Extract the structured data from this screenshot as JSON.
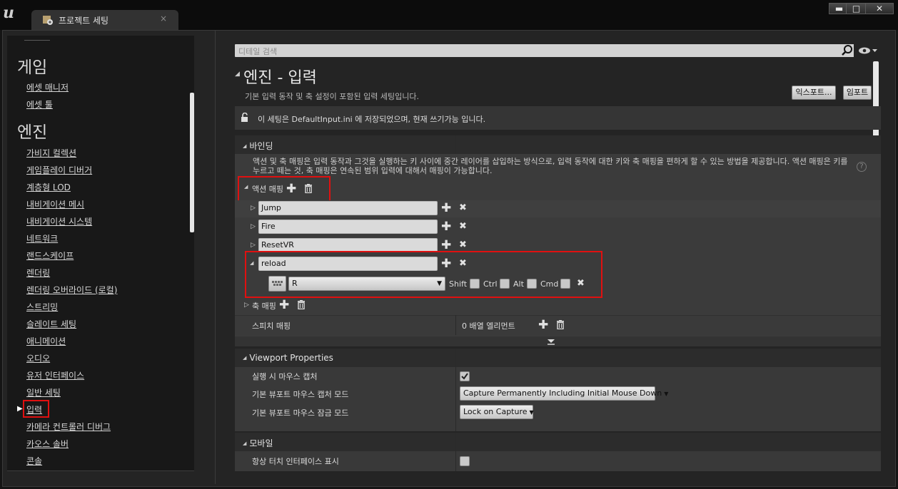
{
  "window": {
    "tab_label": "프로젝트 세팅",
    "tab_close": "×",
    "buttons": {
      "minimize": "▬",
      "maximize": "□",
      "close": "✕"
    }
  },
  "sidebar": {
    "sections": [
      {
        "title": "게임",
        "items": [
          "에셋 매니저",
          "에셋 툴"
        ]
      },
      {
        "title": "엔진",
        "items": [
          "가비지 컬렉션",
          "게임플레이 디버거",
          "계층형 LOD",
          "내비게이션 메시",
          "내비게이션 시스템",
          "네트워크",
          "랜드스케이프",
          "렌더링",
          "렌더링 오버라이드 (로컬)",
          "스트리밍",
          "슬레이트 세팅",
          "애니메이션",
          "오디오",
          "유저 인터페이스",
          "일반 세팅",
          "입력",
          "카메라 컨트롤러 디버그",
          "카오스 솔버",
          "콘솔"
        ]
      }
    ],
    "selected_item": "입력"
  },
  "search": {
    "placeholder": "디테일 검색"
  },
  "page": {
    "title": "엔진 - 입력",
    "description": "기본 입력 동작 및 축 설정이 포함된 입력 세팅입니다.",
    "export_label": "익스포트...",
    "import_label": "임포트",
    "info": "이 세팅은 DefaultInput.ini 에 저장되었으며, 현재 쓰기가능 입니다."
  },
  "bindings": {
    "title": "바인딩",
    "description": "액션 및 축 매핑은 입력 동작과 그것을 실행하는 키 사이에 중간 레이어를 삽입하는 방식으로, 입력 동작에 대한 키와 축 매핑을 편하게 할 수 있는 방법을 제공합니다. 액션 매핑은 키를 누르고 떼는 것, 축 매핑은 연속된 범위 입력에 대해서 매핑이 가능합니다.",
    "help": "?",
    "action_mappings_label": "액션 매핑",
    "actions": [
      "Jump",
      "Fire",
      "ResetVR",
      "reload"
    ],
    "reload_key": "R",
    "modifiers": [
      "Shift",
      "Ctrl",
      "Alt",
      "Cmd"
    ],
    "axis_mappings_label": "축 매핑",
    "speech_label": "스피치 매핑",
    "speech_value": "0 배열 엘리먼트"
  },
  "viewport": {
    "title": "Viewport Properties",
    "capture_on_play_label": "실행 시 마우스 캡처",
    "capture_on_play": true,
    "capture_mode_label": "기본 뷰포트 마우스 캡처 모드",
    "capture_mode_value": "Capture Permanently Including Initial Mouse Down",
    "lock_mode_label": "기본 뷰포트 마우스 잠금 모드",
    "lock_mode_value": "Lock on Capture"
  },
  "mobile": {
    "title": "모바일",
    "touch_interface_label": "항상 터치 인터페이스 표시",
    "touch_interface": false
  },
  "icons": {
    "plus": "✚",
    "close": "✖",
    "expanded_arrow": "◢",
    "collapsed_arrow": "▷",
    "selected_arrow": "▶",
    "dropdown_arrow": "▼"
  },
  "colors": {
    "highlight_red": "#e01010",
    "panel": "#242424",
    "row": "#393939"
  }
}
